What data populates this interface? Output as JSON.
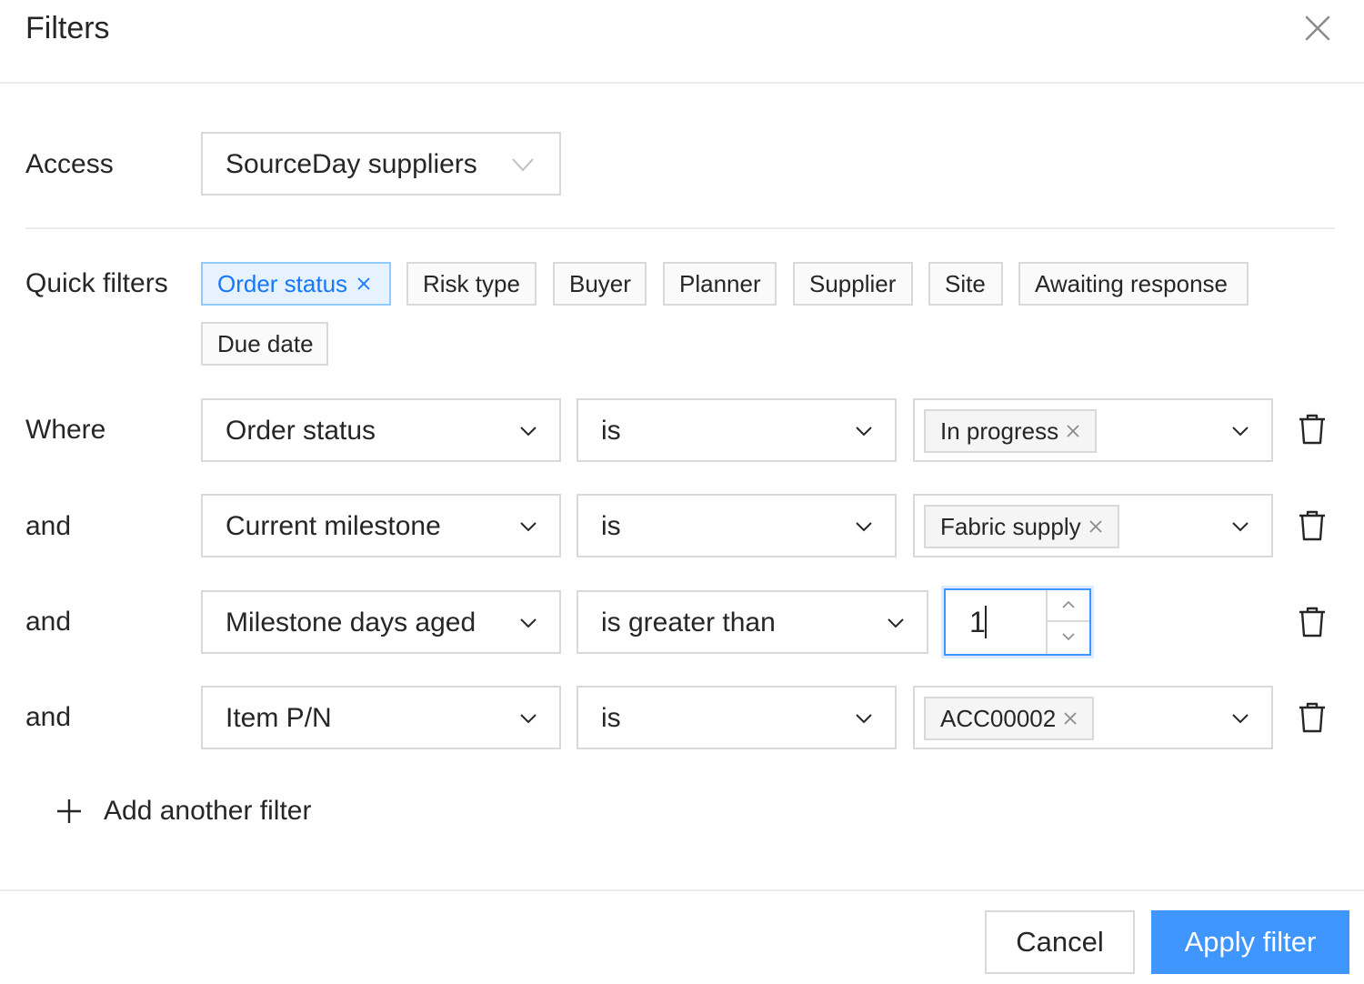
{
  "dialog": {
    "title": "Filters"
  },
  "access": {
    "label": "Access",
    "value": "SourceDay suppliers"
  },
  "quick_filters": {
    "label": "Quick filters",
    "chips": [
      {
        "label": "Order status",
        "active": true
      },
      {
        "label": "Risk type",
        "active": false
      },
      {
        "label": "Buyer",
        "active": false
      },
      {
        "label": "Planner",
        "active": false
      },
      {
        "label": "Supplier",
        "active": false
      },
      {
        "label": "Site",
        "active": false
      },
      {
        "label": "Awaiting response",
        "active": false
      },
      {
        "label": "Due date",
        "active": false
      }
    ]
  },
  "filters": [
    {
      "connector": "Where",
      "field": "Order status",
      "operator": "is",
      "value_tag": "In progress"
    },
    {
      "connector": "and",
      "field": "Current milestone",
      "operator": "is",
      "value_tag": "Fabric supply"
    },
    {
      "connector": "and",
      "field": "Milestone days aged",
      "operator": "is greater than",
      "value_number": "1"
    },
    {
      "connector": "and",
      "field": "Item P/N",
      "operator": "is",
      "value_tag": "ACC00002"
    }
  ],
  "add_filter": {
    "label": "Add another filter"
  },
  "footer": {
    "cancel_label": "Cancel",
    "apply_label": "Apply filter"
  },
  "colors": {
    "accent": "#4096ff",
    "active_chip_bg": "#e6f2ff",
    "active_chip_text": "#1677ff",
    "border": "#d9d9d9"
  }
}
